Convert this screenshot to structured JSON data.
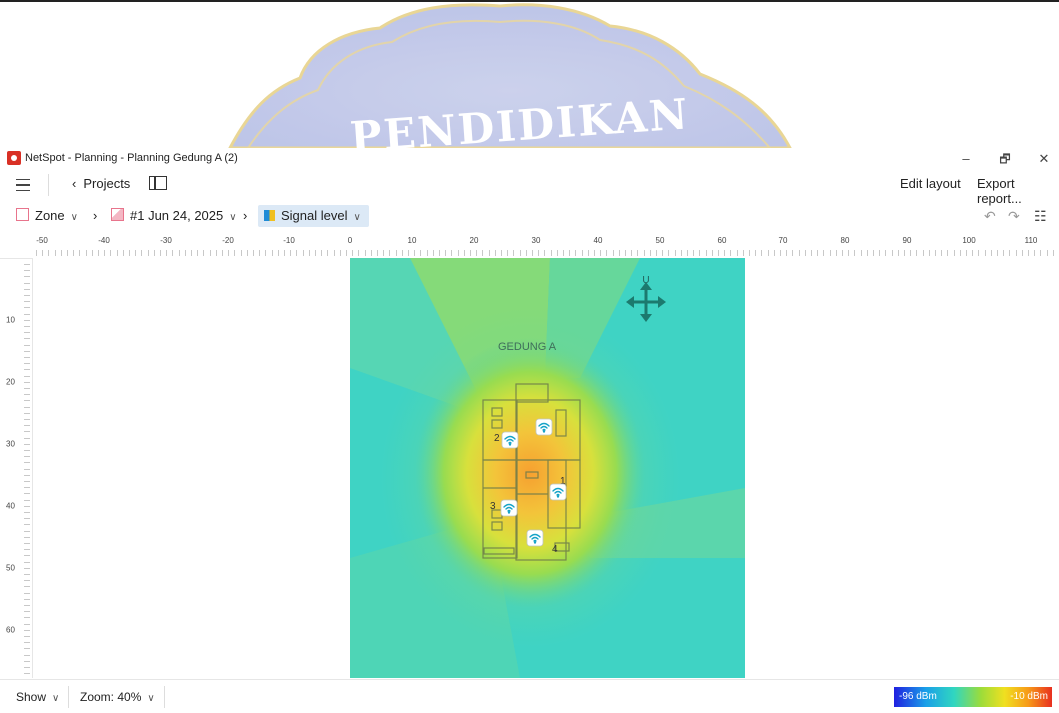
{
  "window": {
    "title": "NetSpot - Planning - Planning Gedung A (2)",
    "controls": [
      "–",
      "🗗",
      "✕"
    ]
  },
  "toolbar": {
    "projects_label": "Projects",
    "edit_layout_label": "Edit layout",
    "export_report_label": "Export report..."
  },
  "breadcrumb": {
    "zone_label": "Zone",
    "snapshot_label": "#1 Jun 24, 2025",
    "visualization_label": "Signal level"
  },
  "ruler": {
    "x_labels": [
      "-50",
      "-40",
      "-30",
      "-20",
      "-10",
      "0",
      "10",
      "20",
      "30",
      "40",
      "50",
      "60",
      "70",
      "80",
      "90",
      "100",
      "110"
    ],
    "y_labels": [
      "10",
      "20",
      "30",
      "40",
      "50",
      "60"
    ]
  },
  "map": {
    "building_label": "GEDUNG A",
    "compass_label": "U",
    "room_labels": [
      "2",
      "1",
      "3",
      "4"
    ],
    "access_points": 5
  },
  "statusbar": {
    "show_label": "Show",
    "zoom_label": "Zoom: 40%",
    "legend_min": "-96 dBm",
    "legend_max": "-10 dBm"
  },
  "banner": {
    "seal_text": "PENDIDIKAN"
  },
  "colors": {
    "accent": "#dce9f6",
    "app_icon": "#d93025",
    "map_teal": "#32d2c8",
    "map_yellow": "#f2d43a",
    "map_orange": "#f6a33a"
  }
}
